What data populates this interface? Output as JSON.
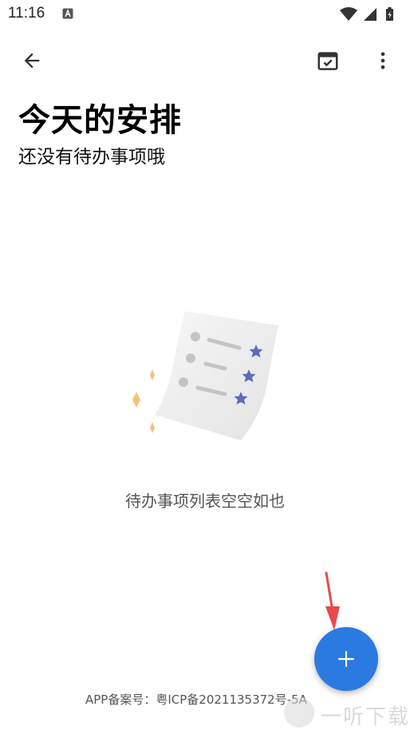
{
  "status_bar": {
    "time": "11:16",
    "icons": [
      "font-a-icon",
      "wifi-icon",
      "cell-signal-icon",
      "battery-charging-icon"
    ]
  },
  "toolbar": {
    "back_icon": "arrow-left-icon",
    "calendar_icon": "calendar-check-icon",
    "more_icon": "more-vertical-icon"
  },
  "header": {
    "title": "今天的安排",
    "subtitle": "还没有待办事项哦"
  },
  "empty_state": {
    "illustration": "checklist-paper-with-stars",
    "message": "待办事项列表空空如也"
  },
  "fab": {
    "icon": "plus-icon",
    "color": "#2a7ae2"
  },
  "footer": {
    "icp": "APP备案号：粤ICP备2021135372号-5A"
  },
  "watermark": {
    "text": "一听下载",
    "logo_glyph": "听"
  },
  "colors": {
    "accent": "#2a7ae2",
    "star": "#5b6bbf",
    "sparkle": "#f5c27a",
    "arrow": "#e84a4a"
  }
}
